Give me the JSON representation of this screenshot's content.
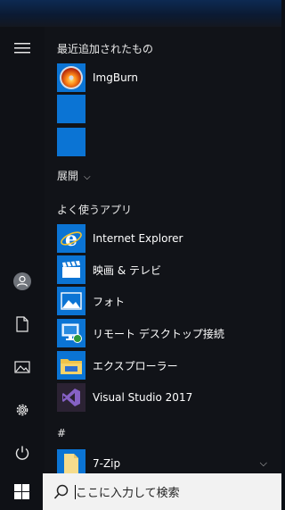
{
  "sections": {
    "recent_title": "最近追加されたもの",
    "expand_label": "展開",
    "frequent_title": "よく使うアプリ",
    "hash_label": "#"
  },
  "recent_apps": [
    {
      "label": "ImgBurn",
      "icon": "imgburn-icon"
    },
    {
      "label": "",
      "icon": "blank-tile"
    },
    {
      "label": "",
      "icon": "blank-tile"
    }
  ],
  "frequent_apps": [
    {
      "label": "Internet Explorer",
      "icon": "internet-explorer-icon"
    },
    {
      "label": "映画 & テレビ",
      "icon": "movies-tv-icon"
    },
    {
      "label": "フォト",
      "icon": "photos-icon"
    },
    {
      "label": "リモート デスクトップ接続",
      "icon": "remote-desktop-icon"
    },
    {
      "label": "エクスプローラー",
      "icon": "file-explorer-icon"
    },
    {
      "label": "Visual Studio 2017",
      "icon": "visual-studio-icon"
    }
  ],
  "hash_apps": [
    {
      "label": "7-Zip",
      "icon": "folder-icon"
    }
  ],
  "taskbar": {
    "search_placeholder": "ここに入力して検索"
  },
  "colors": {
    "tile_blue": "#0b74d4",
    "menu_bg": "#111318",
    "visual_studio_purple": "#68217a"
  }
}
